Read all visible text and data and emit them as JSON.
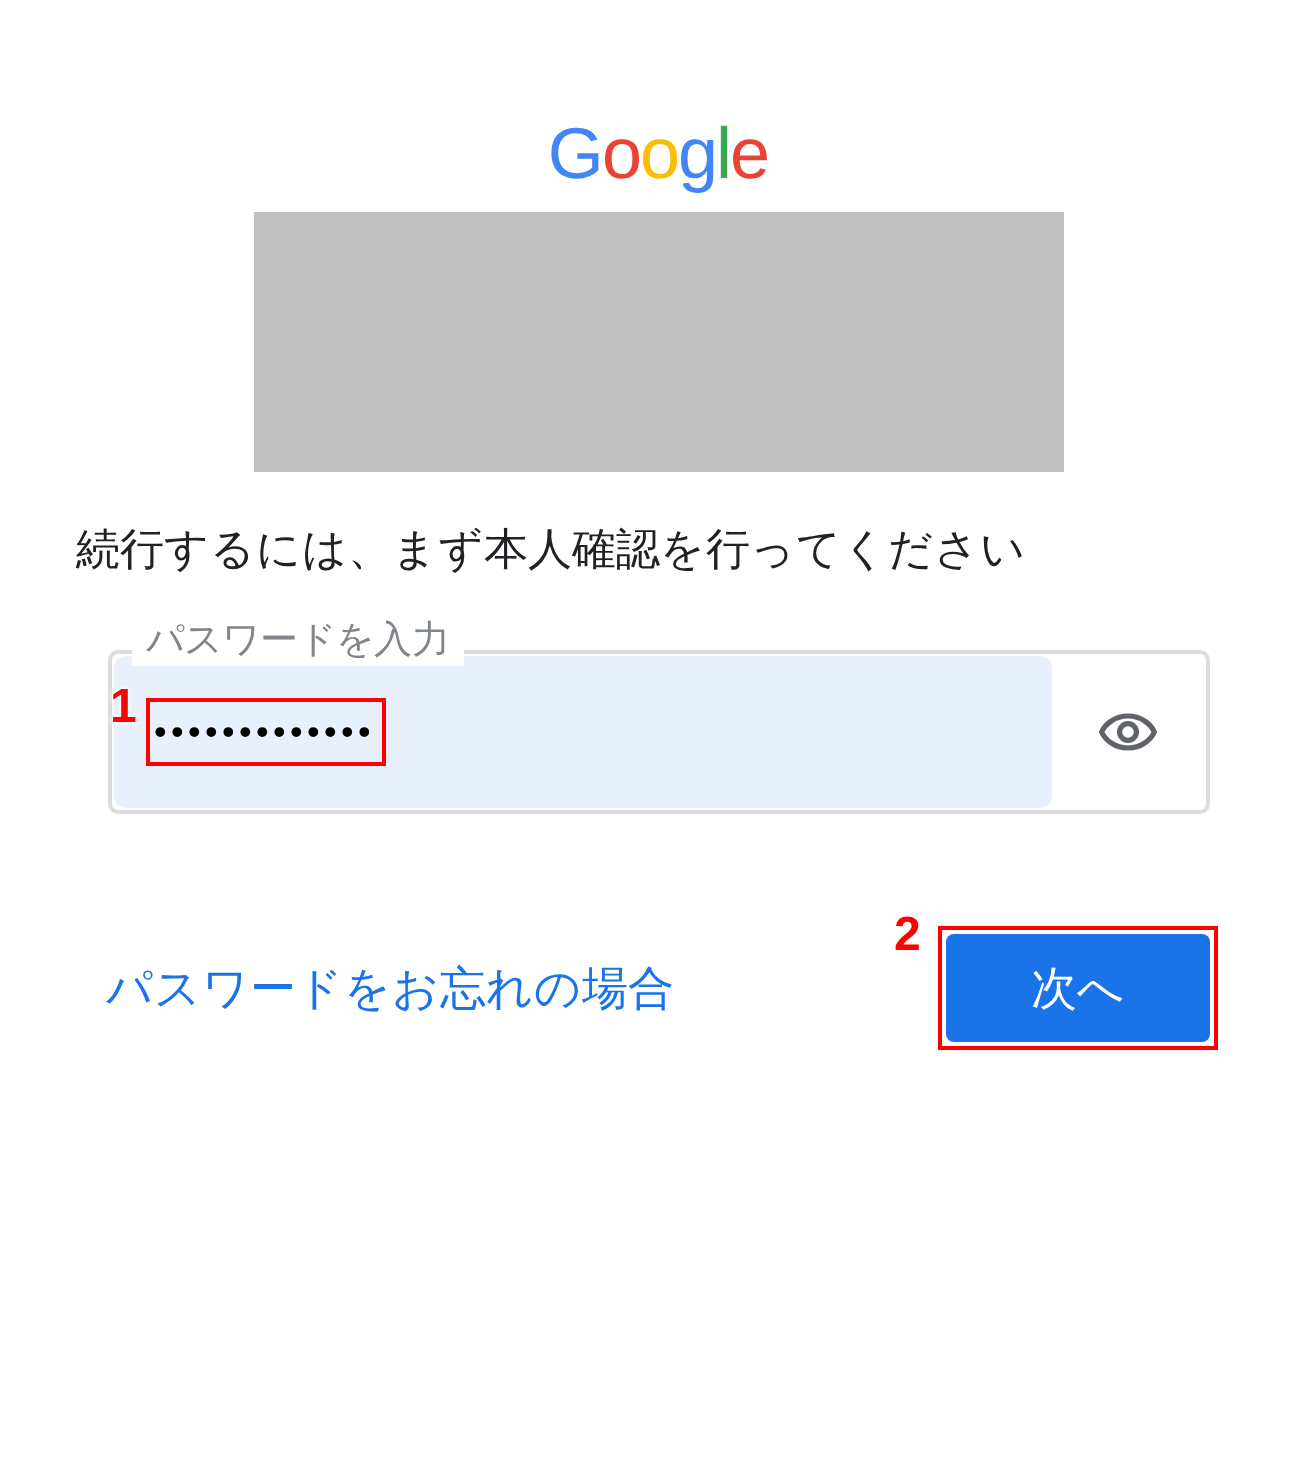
{
  "logo": {
    "letters": [
      {
        "char": "G",
        "color": "#4285f4"
      },
      {
        "char": "o",
        "color": "#ea4335"
      },
      {
        "char": "o",
        "color": "#fbbc05"
      },
      {
        "char": "g",
        "color": "#4285f4"
      },
      {
        "char": "l",
        "color": "#34a853"
      },
      {
        "char": "e",
        "color": "#ea4335"
      }
    ]
  },
  "prompt": "続行するには、まず本人確認を行ってください",
  "password_field": {
    "label": "パスワードを入力",
    "value": "•••••••••••••",
    "autofilled": true,
    "callout": "1"
  },
  "forgot_link": "パスワードをお忘れの場合",
  "next_button": {
    "label": "次へ",
    "callout": "2"
  }
}
